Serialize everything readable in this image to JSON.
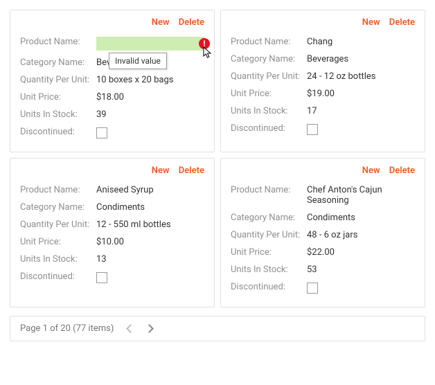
{
  "labels": {
    "productName": "Product Name:",
    "categoryName": "Category Name:",
    "quantityPerUnit": "Quantity Per Unit:",
    "unitPrice": "Unit Price:",
    "unitsInStock": "Units In Stock:",
    "discontinued": "Discontinued:"
  },
  "actions": {
    "new": "New",
    "delete": "Delete"
  },
  "tooltip": "Invalid value",
  "errorGlyph": "!",
  "cards": [
    {
      "editing": true,
      "productName": "",
      "categoryName": "Beverages",
      "quantityPerUnit": "10 boxes x 20 bags",
      "unitPrice": "$18.00",
      "unitsInStock": "39",
      "discontinued": false
    },
    {
      "editing": false,
      "productName": "Chang",
      "categoryName": "Beverages",
      "quantityPerUnit": "24 - 12 oz bottles",
      "unitPrice": "$19.00",
      "unitsInStock": "17",
      "discontinued": false
    },
    {
      "editing": false,
      "productName": "Aniseed Syrup",
      "categoryName": "Condiments",
      "quantityPerUnit": "12 - 550 ml bottles",
      "unitPrice": "$10.00",
      "unitsInStock": "13",
      "discontinued": false
    },
    {
      "editing": false,
      "productName": "Chef Anton's Cajun Seasoning",
      "categoryName": "Condiments",
      "quantityPerUnit": "48 - 6 oz jars",
      "unitPrice": "$22.00",
      "unitsInStock": "53",
      "discontinued": false
    }
  ],
  "pager": {
    "text": "Page 1 of 20 (77 items)"
  }
}
